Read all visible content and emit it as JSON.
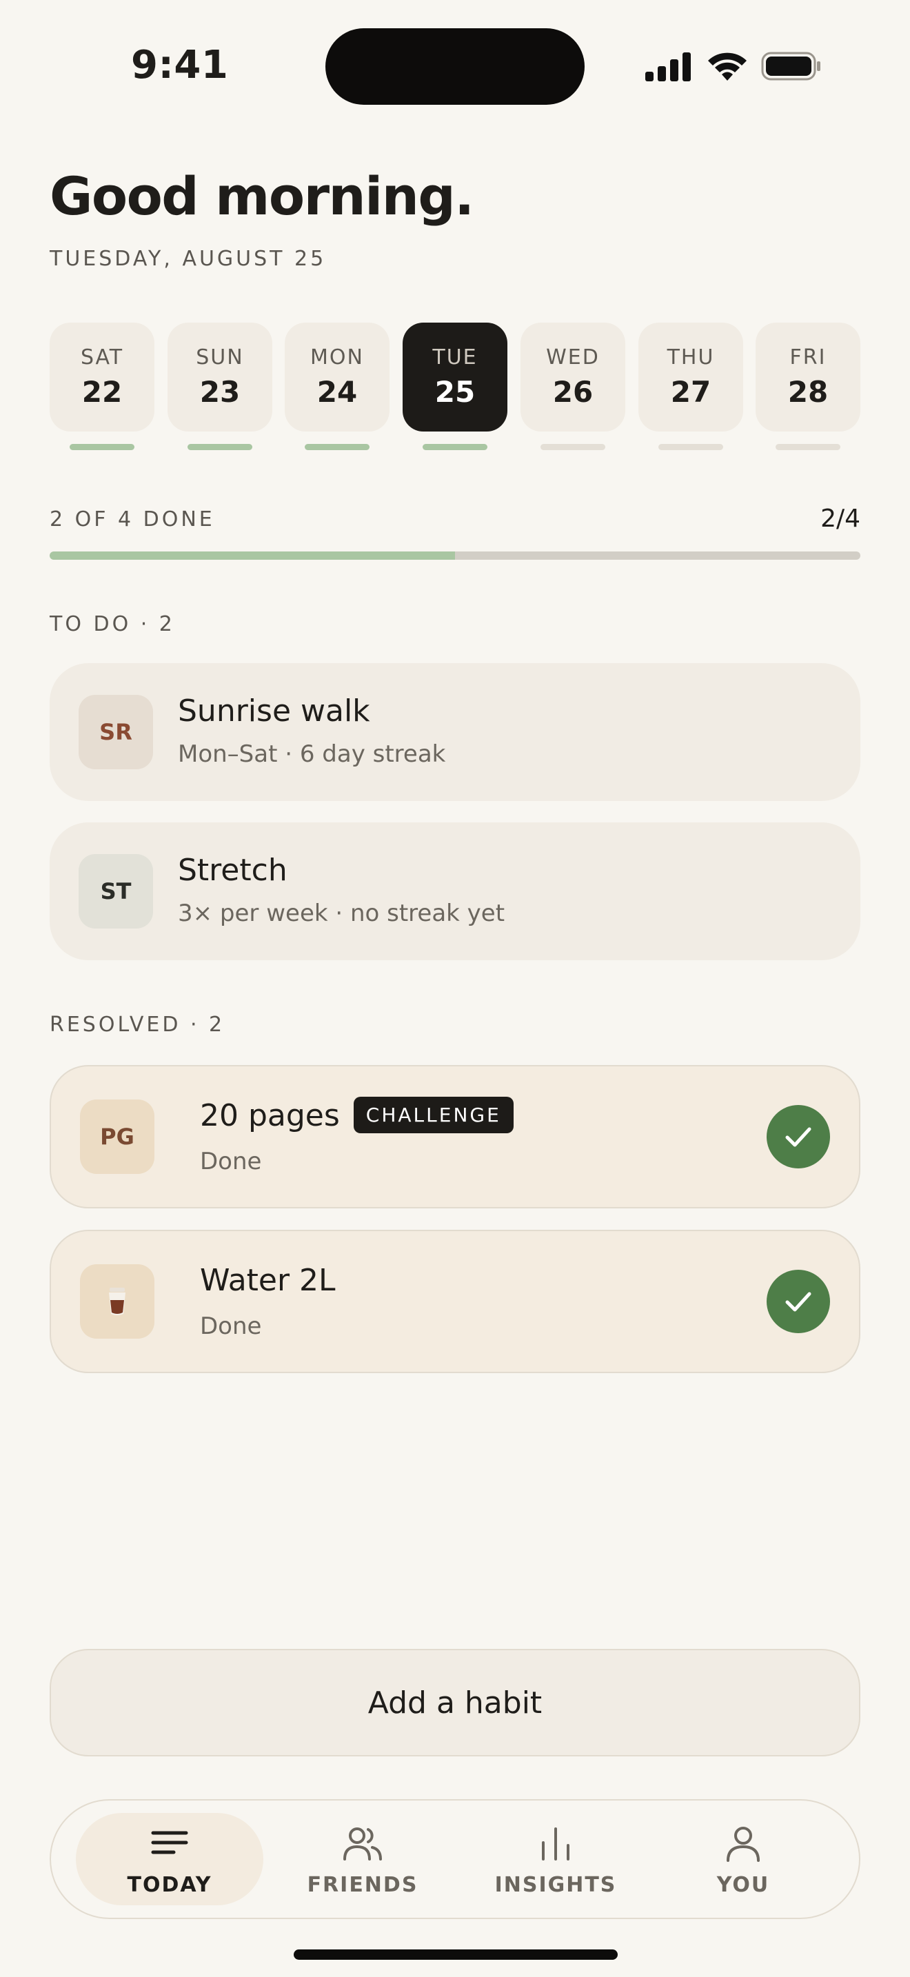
{
  "status": {
    "time": "9:41"
  },
  "header": {
    "greeting": "Good morning.",
    "date": "TUESDAY, AUGUST 25"
  },
  "week": [
    {
      "name": "SAT",
      "num": "22",
      "done": true,
      "active": false
    },
    {
      "name": "SUN",
      "num": "23",
      "done": true,
      "active": false
    },
    {
      "name": "MON",
      "num": "24",
      "done": true,
      "active": false
    },
    {
      "name": "TUE",
      "num": "25",
      "done": true,
      "active": true
    },
    {
      "name": "WED",
      "num": "26",
      "done": false,
      "active": false
    },
    {
      "name": "THU",
      "num": "27",
      "done": false,
      "active": false
    },
    {
      "name": "FRI",
      "num": "28",
      "done": false,
      "active": false
    }
  ],
  "progress": {
    "label": "2 OF 4 DONE",
    "count": "2/4",
    "fraction": 0.5
  },
  "todo": {
    "label": "TO DO · 2",
    "items": [
      {
        "initials": "SR",
        "title": "Sunrise walk",
        "sub": "Mon–Sat · 6 day streak",
        "badge_bg": "#e6ddd2",
        "badge_fg": "#8a4a32"
      },
      {
        "initials": "ST",
        "title": "Stretch",
        "sub": "3× per week · no streak yet",
        "badge_bg": "#e2e1d8",
        "badge_fg": "#2b2d28"
      }
    ]
  },
  "resolved": {
    "label": "RESOLVED · 2",
    "items": [
      {
        "initials": "PG",
        "title": "20 pages",
        "chip": "CHALLENGE",
        "sub": "Done",
        "badge_bg": "#ecdcc4",
        "badge_fg": "#7a4a32"
      },
      {
        "icon": "coffee-cup-icon",
        "title": "Water 2L",
        "sub": "Done",
        "badge_bg": "#ecdcc4"
      }
    ]
  },
  "add_button": "Add a habit",
  "tabs": [
    {
      "label": "TODAY",
      "icon": "list-icon",
      "active": true
    },
    {
      "label": "FRIENDS",
      "icon": "people-icon",
      "active": false
    },
    {
      "label": "INSIGHTS",
      "icon": "bars-icon",
      "active": false
    },
    {
      "label": "YOU",
      "icon": "person-icon",
      "active": false
    }
  ],
  "colors": {
    "accent_green": "#4e7e48",
    "progress_green": "#a9c6a2",
    "dark": "#1d1b18"
  }
}
